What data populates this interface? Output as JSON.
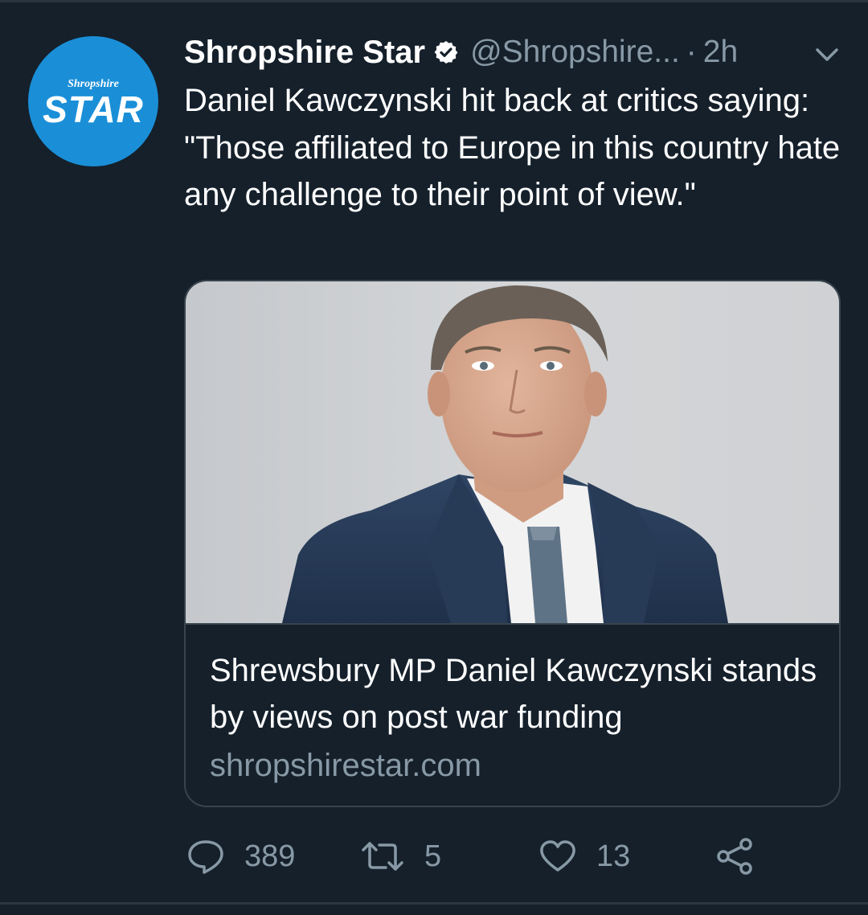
{
  "account": {
    "avatar_small_text": "Shropshire",
    "avatar_big_text": "STAR",
    "display_name": "Shropshire Star",
    "handle": "@Shropshire...",
    "separator": "·",
    "time": "2h",
    "verified": true
  },
  "tweet": {
    "text": "Daniel Kawczynski hit back at critics saying: \"Those affiliated to Europe in this country hate any challenge to their point of view.\""
  },
  "card": {
    "title": "Shrewsbury MP Daniel Kawczynski stands by views on post war funding",
    "domain": "shropshirestar.com"
  },
  "actions": {
    "reply_count": "389",
    "retweet_count": "5",
    "like_count": "13"
  },
  "colors": {
    "background": "#15202b",
    "muted_text": "#8899a6",
    "avatar_blue": "#1a8fd8",
    "border": "#38444d"
  },
  "icons": [
    "verified-badge-icon",
    "chevron-down-icon",
    "reply-icon",
    "retweet-icon",
    "like-icon",
    "share-icon"
  ]
}
